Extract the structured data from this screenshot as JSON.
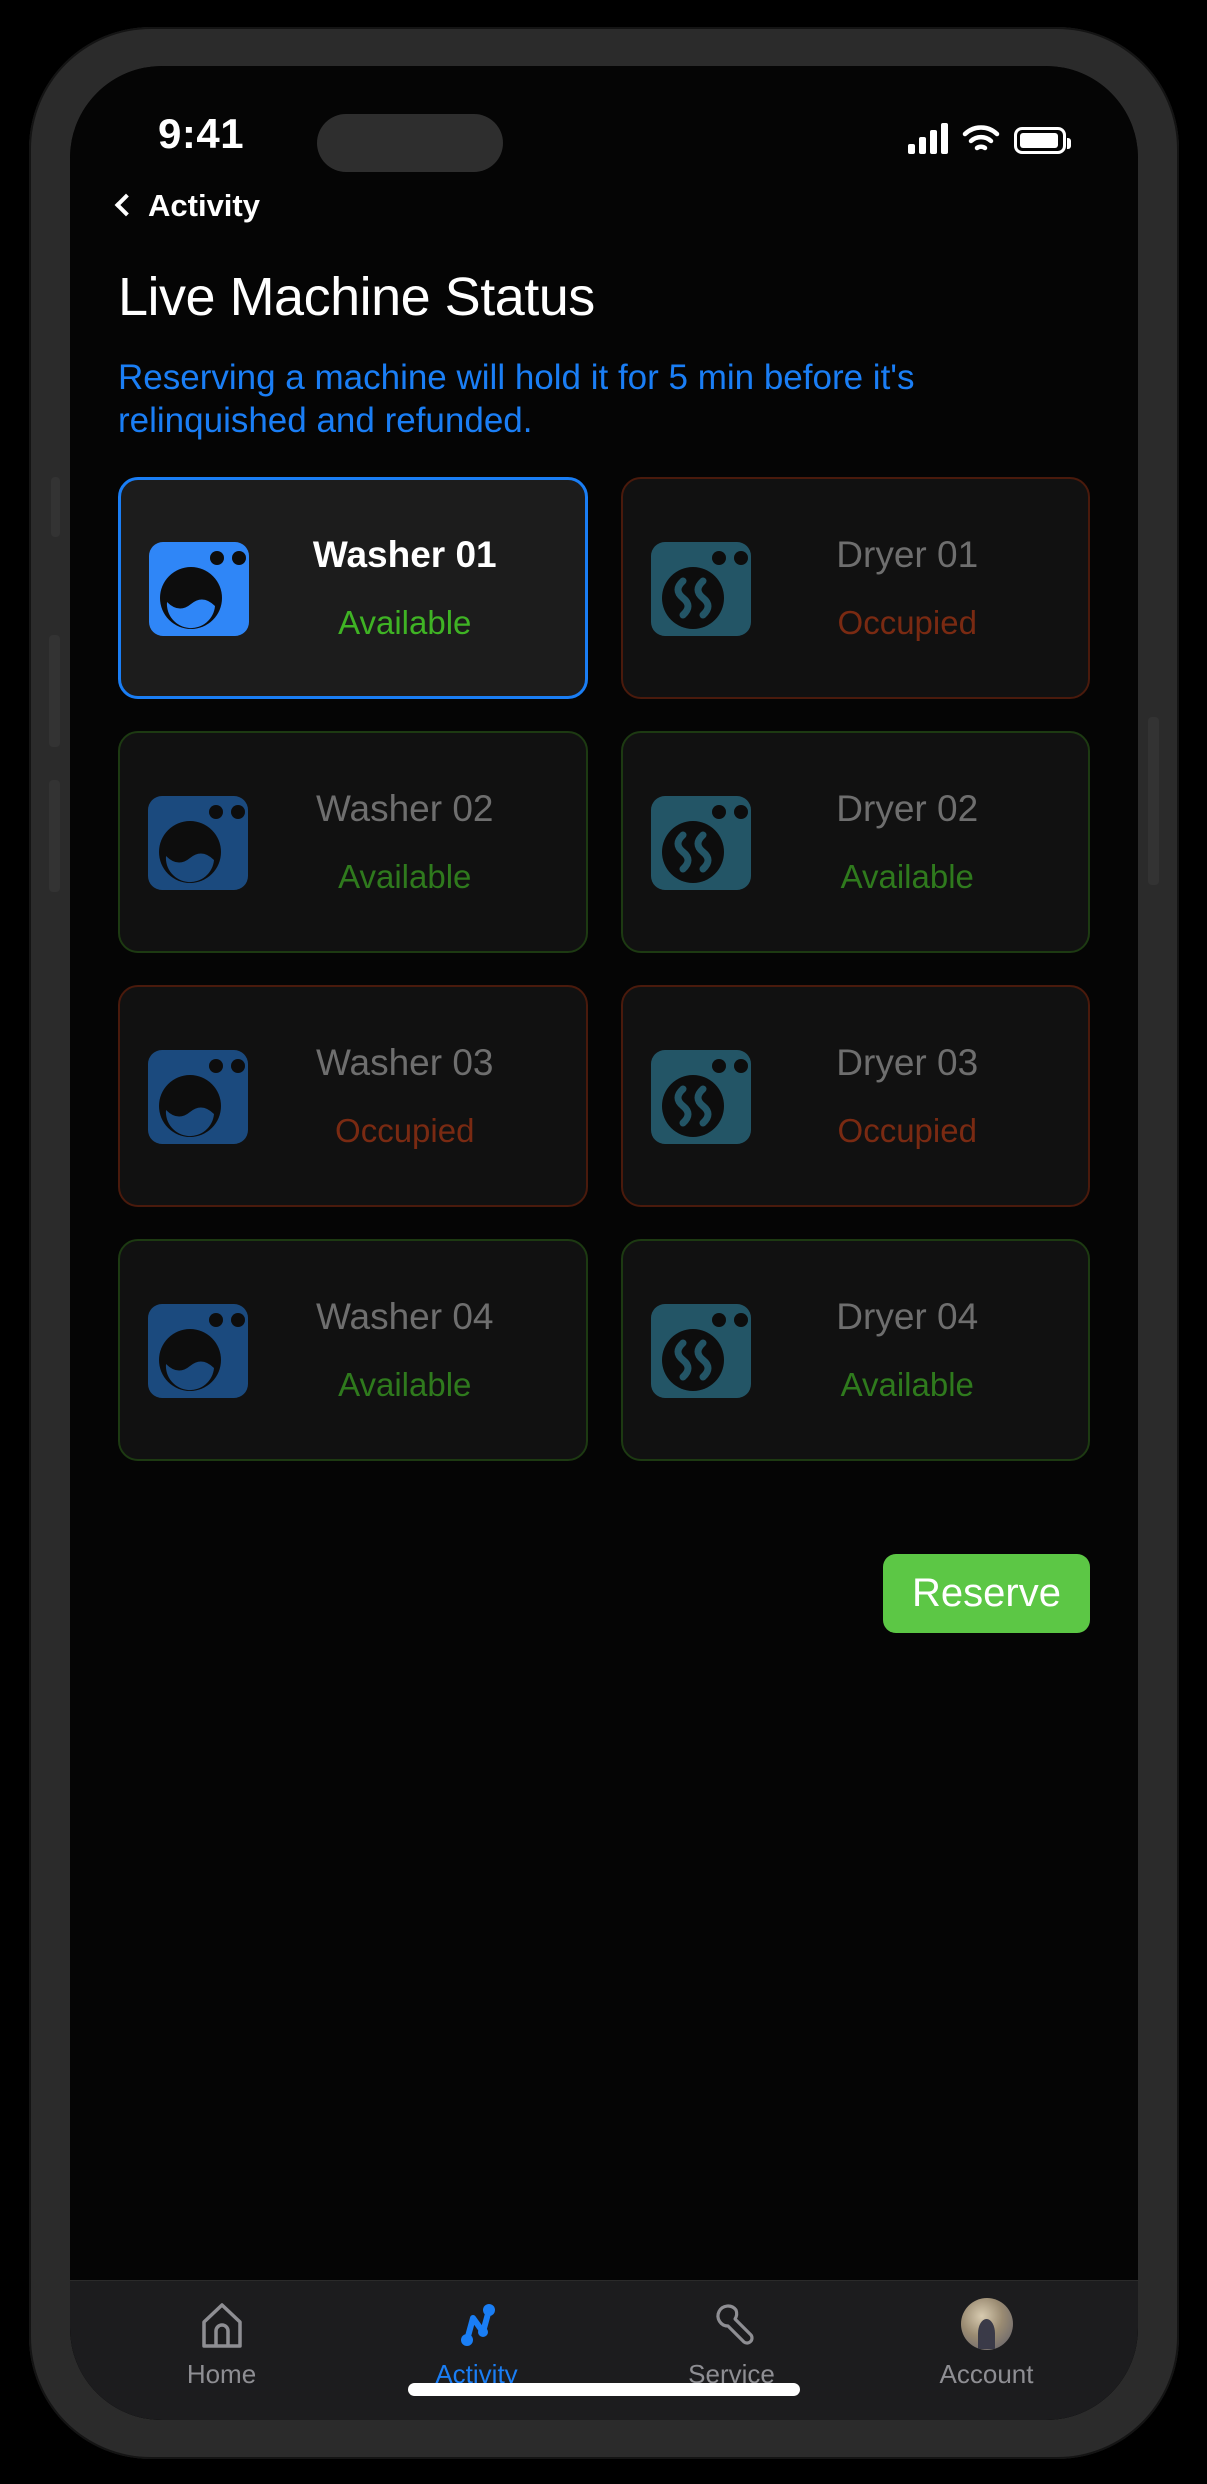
{
  "status_bar": {
    "time": "9:41",
    "signal_icon": "cellular-signal-icon",
    "wifi_icon": "wifi-icon",
    "battery_icon": "battery-icon"
  },
  "nav": {
    "back_label": "Activity",
    "back_icon": "chevron-left-icon"
  },
  "header": {
    "title": "Live Machine Status",
    "subtitle": "Reserving a machine will hold it for 5 min before it's relinquished and refunded."
  },
  "machines": [
    {
      "name": "Washer 01",
      "status": "Available",
      "type": "washer",
      "state": "available",
      "selected": true
    },
    {
      "name": "Dryer 01",
      "status": "Occupied",
      "type": "dryer",
      "state": "occupied",
      "selected": false
    },
    {
      "name": "Washer 02",
      "status": "Available",
      "type": "washer",
      "state": "available",
      "selected": false
    },
    {
      "name": "Dryer 02",
      "status": "Available",
      "type": "dryer",
      "state": "available",
      "selected": false
    },
    {
      "name": "Washer 03",
      "status": "Occupied",
      "type": "washer",
      "state": "occupied",
      "selected": false
    },
    {
      "name": "Dryer 03",
      "status": "Occupied",
      "type": "dryer",
      "state": "occupied",
      "selected": false
    },
    {
      "name": "Washer 04",
      "status": "Available",
      "type": "washer",
      "state": "available",
      "selected": false
    },
    {
      "name": "Dryer 04",
      "status": "Available",
      "type": "dryer",
      "state": "available",
      "selected": false
    }
  ],
  "actions": {
    "reserve_label": "Reserve"
  },
  "tabbar": {
    "items": [
      {
        "label": "Home",
        "icon": "home-icon",
        "active": false
      },
      {
        "label": "Activity",
        "icon": "activity-icon",
        "active": true
      },
      {
        "label": "Service",
        "icon": "wrench-icon",
        "active": false
      },
      {
        "label": "Account",
        "icon": "avatar-icon",
        "active": false
      }
    ]
  },
  "colors": {
    "accent_blue": "#1a7ef5",
    "available_green": "#3fb324",
    "occupied_red": "#7a2a12",
    "reserve_green": "#5cc745",
    "washer_icon": "#2f86f7",
    "dryer_icon": "#2d6e85",
    "screen_bg": "#050505"
  }
}
